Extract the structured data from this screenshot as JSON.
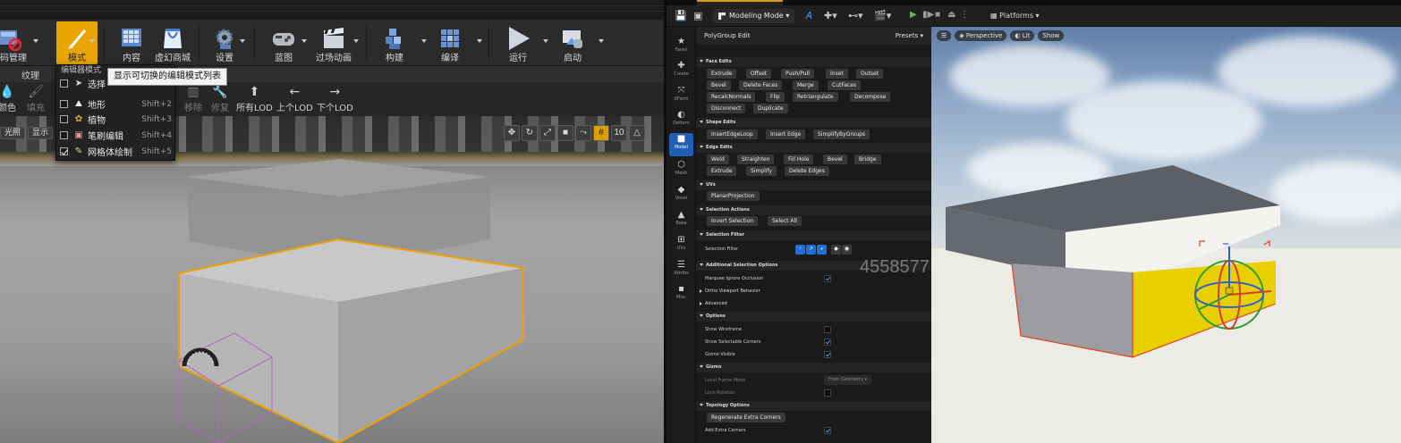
{
  "left": {
    "toolbar": [
      {
        "label": "源码管理",
        "icon": "source-control-icon"
      },
      {
        "label": "模式",
        "icon": "modes-icon"
      },
      {
        "label": "内容",
        "icon": "content-icon"
      },
      {
        "label": "虚幻商城",
        "icon": "marketplace-icon"
      },
      {
        "label": "设置",
        "icon": "settings-icon"
      },
      {
        "label": "蓝图",
        "icon": "blueprint-icon"
      },
      {
        "label": "过场动画",
        "icon": "cinematics-icon"
      },
      {
        "label": "构建",
        "icon": "build-icon"
      },
      {
        "label": "编译",
        "icon": "compile-icon"
      },
      {
        "label": "运行",
        "icon": "play-icon"
      },
      {
        "label": "启动",
        "icon": "launch-icon"
      }
    ],
    "tabs": [
      "纹理"
    ],
    "tools": [
      {
        "label": "颜色",
        "glyph": "💧"
      },
      {
        "label": "填充",
        "glyph": "🖌"
      },
      {
        "label": "移除",
        "glyph": "▥"
      },
      {
        "label": "修复",
        "glyph": "🔧"
      },
      {
        "label": "所有LOD",
        "glyph": "⬆"
      },
      {
        "label": "上个LOD",
        "glyph": "←"
      },
      {
        "label": "下个LOD",
        "glyph": "→"
      }
    ],
    "viewport": {
      "chips": [
        "光照",
        "显示"
      ],
      "grid_value": "10"
    },
    "mode_menu": {
      "header": "编辑器模式",
      "items": [
        {
          "label": "选择",
          "shortcut": "",
          "checked": false,
          "icon": "select-arrow-icon"
        },
        {
          "label": "地形",
          "shortcut": "Shift+2",
          "checked": false,
          "icon": "landscape-icon"
        },
        {
          "label": "植物",
          "shortcut": "Shift+3",
          "checked": false,
          "icon": "foliage-icon"
        },
        {
          "label": "笔刷编辑",
          "shortcut": "Shift+4",
          "checked": false,
          "icon": "brush-edit-icon"
        },
        {
          "label": "网格体绘制",
          "shortcut": "Shift+5",
          "checked": true,
          "icon": "mesh-paint-icon"
        }
      ]
    },
    "tooltip": "显示可切换的编辑模式列表"
  },
  "right": {
    "toolbar": {
      "mode_label": "Modeling Mode",
      "platforms_label": "Platforms"
    },
    "mode_bar": [
      {
        "label": "Faves",
        "glyph": "★"
      },
      {
        "label": "Create",
        "glyph": "✚"
      },
      {
        "label": "XForm",
        "glyph": "⤧"
      },
      {
        "label": "Deform",
        "glyph": "◐"
      },
      {
        "label": "Model",
        "glyph": "■",
        "active": true
      },
      {
        "label": "Mesh",
        "glyph": "⬡"
      },
      {
        "label": "Voxel",
        "glyph": "◆"
      },
      {
        "label": "Bake",
        "glyph": "▲"
      },
      {
        "label": "UVs",
        "glyph": "⊞"
      },
      {
        "label": "Attribs",
        "glyph": "☰"
      },
      {
        "label": "Misc",
        "glyph": "▪"
      }
    ],
    "panel": {
      "title": "PolyGroup Edit",
      "presets": "Presets",
      "sections": {
        "face_edits": "Face Edits",
        "shape_edits": "Shape Edits",
        "edge_edits": "Edge Edits",
        "uvs": "UVs",
        "selection_actions": "Selection Actions",
        "selection_filter": "Selection Filter",
        "additional": "Additional Selection Options",
        "ortho": "Ortho Viewport Behavior",
        "advanced": "Advanced",
        "options": "Options",
        "gizmo": "Gizmo",
        "topology": "Topology Options"
      },
      "face_buttons": [
        [
          "Extrude",
          "Offset",
          "Push/Pull",
          "Inset",
          "Outset"
        ],
        [
          "Bevel",
          "Delete Faces",
          "Merge",
          "CutFaces"
        ],
        [
          "RecalcNormals",
          "Flip",
          "Retriangulate",
          "Decompose"
        ],
        [
          "Disconnect",
          "Duplicate"
        ]
      ],
      "shape_buttons": [
        [
          "InsertEdgeLoop",
          "Insert Edge",
          "SimplifyByGroups"
        ]
      ],
      "edge_buttons": [
        [
          "Weld",
          "Straighten",
          "Fill Hole",
          "Bevel",
          "Bridge"
        ],
        [
          "Extrude",
          "Simplify",
          "Delete Edges"
        ]
      ],
      "uv_buttons": [
        [
          "PlanarProjection"
        ]
      ],
      "selection_buttons": [
        [
          "Invert Selection",
          "Select All"
        ]
      ],
      "selection_filter_label": "Selection Filter",
      "marquee_label": "Marquee Ignore Occlusion",
      "show_wireframe": "Show Wireframe",
      "show_corners": "Show Selectable Corners",
      "gizmo_visible": "Gizmo Visible",
      "local_frame_mode": "Local Frame Mode",
      "local_frame_value": "From Geometry",
      "lock_rotation": "Lock Rotation",
      "regenerate": "Regenerate Extra Corners",
      "add_extra_corners": "Add Extra Corners"
    },
    "watermark": "4558577",
    "viewport": {
      "perspective": "Perspective",
      "lit": "Lit",
      "show": "Show"
    }
  }
}
